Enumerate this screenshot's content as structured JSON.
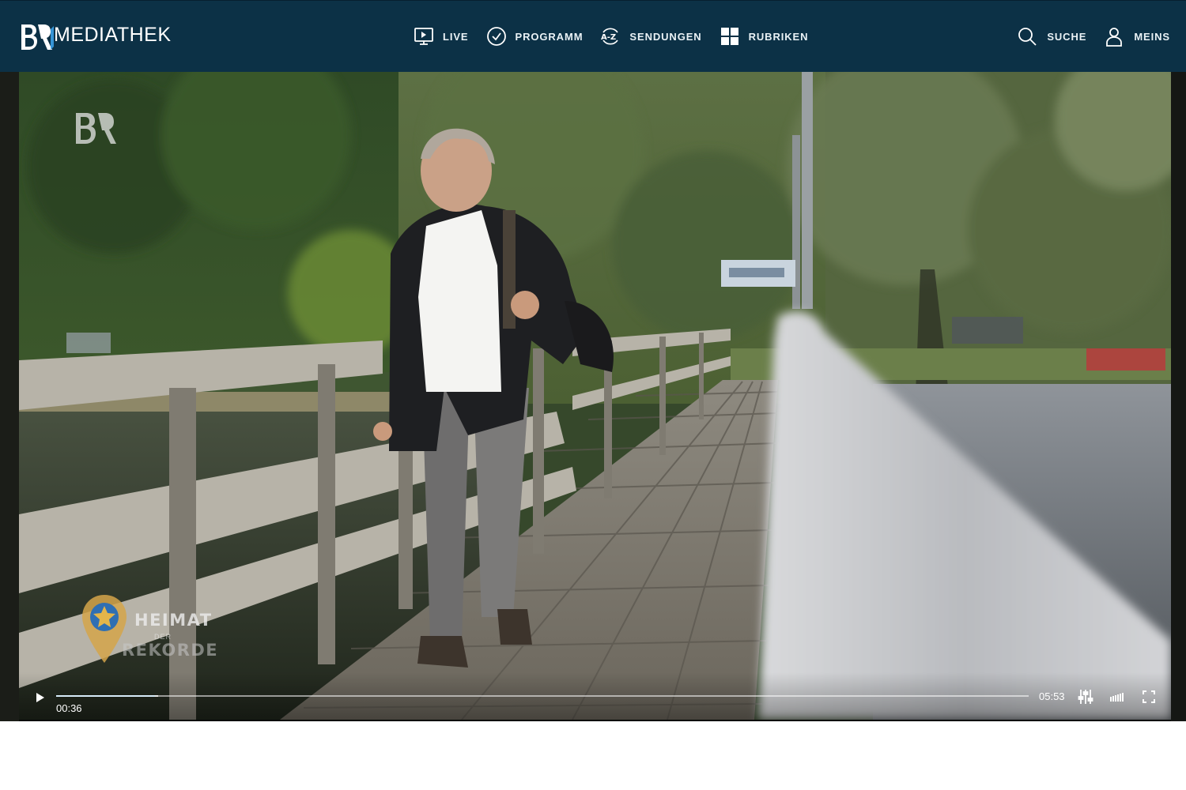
{
  "header": {
    "logo_mark": "BR",
    "logo_text": "MEDIATHEK",
    "nav": [
      {
        "label": "LIVE",
        "icon": "monitor-play-icon"
      },
      {
        "label": "PROGRAMM",
        "icon": "clock-check-icon"
      },
      {
        "label": "SENDUNGEN",
        "icon": "a-z-icon"
      },
      {
        "label": "RUBRIKEN",
        "icon": "grid-icon"
      }
    ],
    "right_nav": [
      {
        "label": "SUCHE",
        "icon": "search-icon"
      },
      {
        "label": "MEINS",
        "icon": "user-icon"
      }
    ]
  },
  "player": {
    "watermark": "BR",
    "show_logo_line1": "HEIMAT",
    "show_logo_line2": "DER",
    "show_logo_line3": "REKORDE",
    "current_time": "00:36",
    "total_time": "05:53",
    "progress": 0.102,
    "buffered": 0.105,
    "controls": [
      "play-icon",
      "settings-sliders-icon",
      "quality-bars-icon",
      "fullscreen-icon"
    ]
  },
  "colors": {
    "header_bg": "#0c3146",
    "accent": "#3aa0e6"
  }
}
